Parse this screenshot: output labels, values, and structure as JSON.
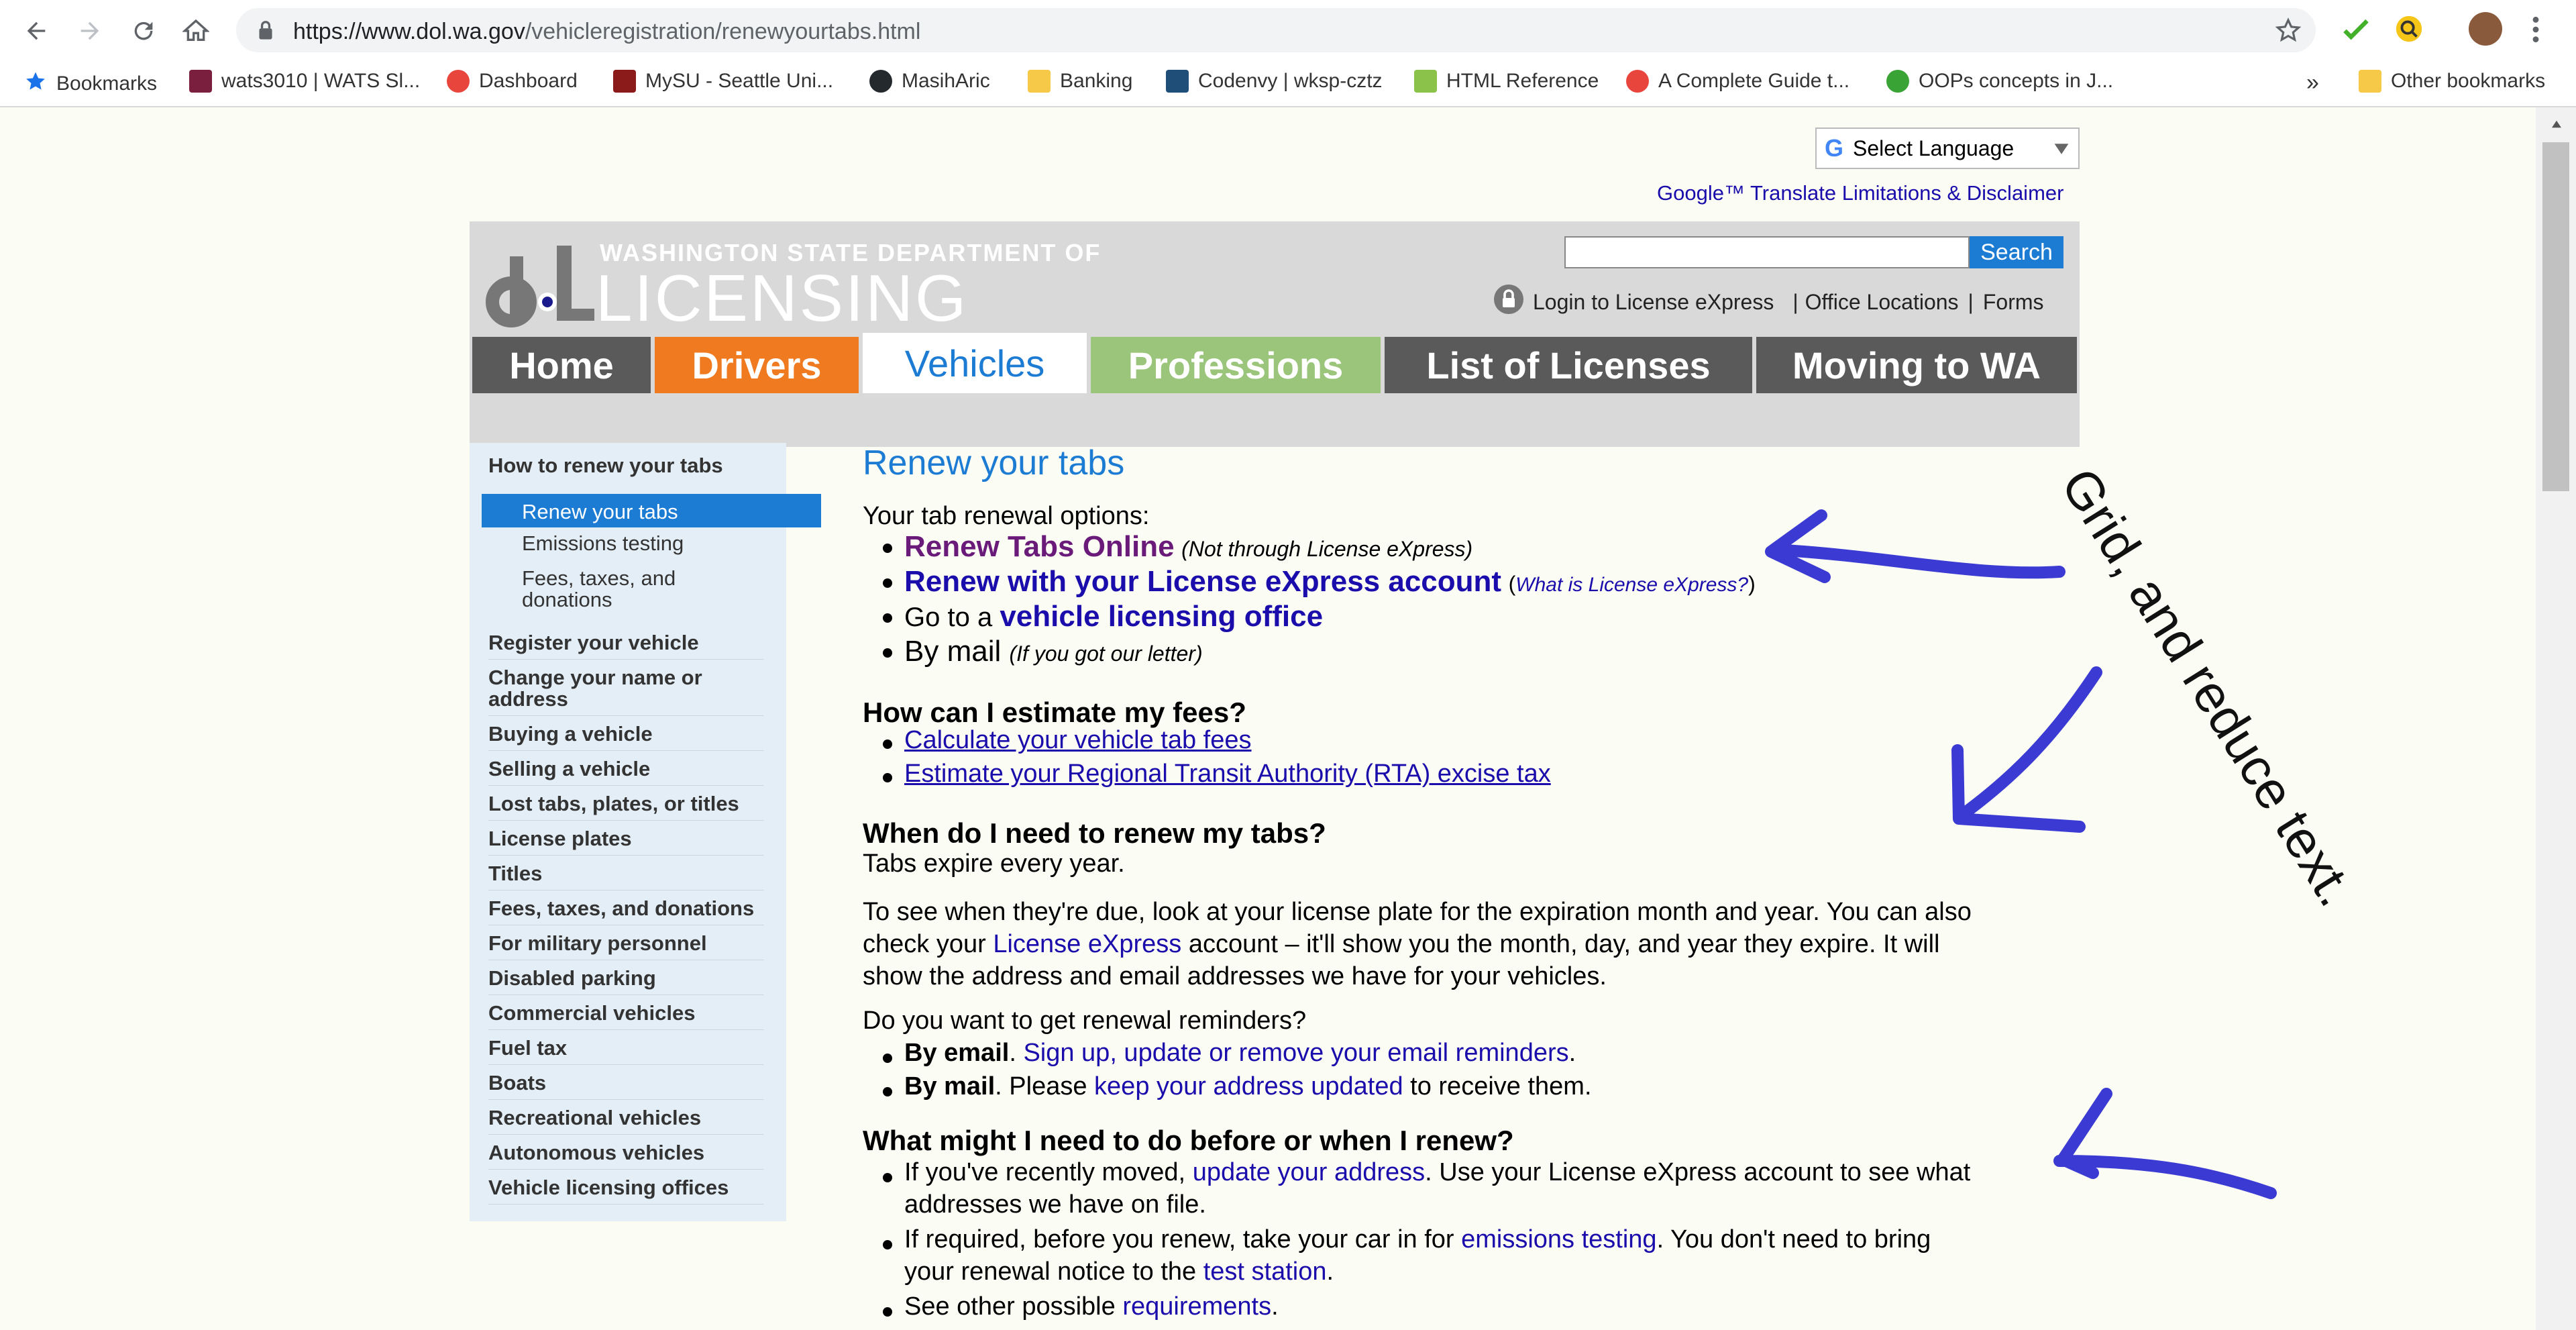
{
  "browser": {
    "url_host": "https://www.dol.wa.gov",
    "url_path": "/vehicleregistration/renewyourtabs.html",
    "bookmarks": [
      {
        "label": "Bookmarks",
        "color": "#1a73e8"
      },
      {
        "label": "wats3010 | WATS Sl...",
        "color": "#7a1f3d"
      },
      {
        "label": "Dashboard",
        "color": "#e8453c"
      },
      {
        "label": "MySU - Seattle Uni...",
        "color": "#8b1a1a"
      },
      {
        "label": "MasihAric",
        "color": "#24292e"
      },
      {
        "label": "Banking",
        "color": "#f7c948"
      },
      {
        "label": "Codenvy | wksp-cztz",
        "color": "#1f4e79"
      },
      {
        "label": "HTML Reference",
        "color": "#8bc34a"
      },
      {
        "label": "A Complete Guide t...",
        "color": "#e8453c"
      },
      {
        "label": "OOPs concepts in J...",
        "color": "#3aa335"
      }
    ],
    "more": "»",
    "other_bookmarks": "Other bookmarks"
  },
  "translate": {
    "label": "Select Language",
    "disclaimer": "Google™ Translate Limitations & Disclaimer"
  },
  "header": {
    "logo_line1": "WASHINGTON STATE DEPARTMENT OF",
    "logo_line2": "LICENSING",
    "search_button": "Search",
    "login": "Login to License eXpress",
    "office": "Office Locations",
    "forms": "Forms",
    "sep": "|",
    "tabs": [
      {
        "label": "Home",
        "color": "#5a5a5a"
      },
      {
        "label": "Drivers",
        "color": "#f07a20"
      },
      {
        "label": "Vehicles",
        "color": "#1c7bd3"
      },
      {
        "label": "Professions",
        "color": "#9bc57a"
      },
      {
        "label": "List of Licenses",
        "color": "#5a5a5a"
      },
      {
        "label": "Moving to WA",
        "color": "#5a5a5a"
      }
    ]
  },
  "sidebar": {
    "heading": "How to renew your tabs",
    "sub": [
      "Renew your tabs",
      "Emissions testing",
      "Fees, taxes, and donations"
    ],
    "items": [
      "Register your vehicle",
      "Change your name or address",
      "Buying a vehicle",
      "Selling a vehicle",
      "Lost tabs, plates, or titles",
      "License plates",
      "Titles",
      "Fees, taxes, and donations",
      "For military personnel",
      "Disabled parking",
      "Commercial vehicles",
      "Fuel tax",
      "Boats",
      "Recreational vehicles",
      "Autonomous vehicles",
      "Vehicle licensing offices"
    ]
  },
  "main": {
    "title": "Renew your tabs",
    "options_intro": "Your tab renewal options:",
    "opt1_link": "Renew Tabs Online",
    "opt1_note": "(Not through License eXpress)",
    "opt2_link": "Renew with your License eXpress account",
    "opt2_open": "(",
    "opt2_note": "What is License eXpress?",
    "opt2_close": ")",
    "opt3_text": "Go to a",
    "opt3_link": "vehicle licensing office",
    "opt4_text": "By mail",
    "opt4_note": "(If you got our letter)",
    "fees_heading": "How can I estimate my fees?",
    "fees_link1": "Calculate your vehicle tab fees",
    "fees_link2": "Estimate your Regional Transit Authority (RTA) excise tax",
    "when_heading": "When do I need to renew my tabs?",
    "when_text": "Tabs expire every year.",
    "due_line1": "To see when they're due, look at your license plate for the expiration month and year. You can also",
    "due_line2_pre": "check your",
    "due_line2_link": "License eXpress",
    "due_line2_post": "account – it'll show you the month, day, and year they expire. It will",
    "due_line3": "show the address and email addresses we have for your vehicles.",
    "reminders_q": "Do you want to get renewal reminders?",
    "rem1_bold": "By email",
    "rem1_dot": ".",
    "rem1_link": "Sign up, update or remove your email reminders",
    "rem1_end": ".",
    "rem2_bold": "By mail",
    "rem2_text": ". Please",
    "rem2_link": "keep your address updated",
    "rem2_end": "to receive them.",
    "before_heading": "What might I need to do before or when I renew?",
    "b1_pre": "If you've recently moved,",
    "b1_link": "update your address",
    "b1_post": ". Use your License eXpress account to see what",
    "b1_line2": "addresses we have on file.",
    "b2_pre": "If required, before you renew, take your car in for",
    "b2_link": "emissions testing",
    "b2_post": ". You don't need to bring",
    "b2_line2_pre": "your renewal notice to the",
    "b2_line2_link": "test station",
    "b2_line2_end": ".",
    "b3_pre": "See other possible",
    "b3_link": "requirements",
    "b3_end": "."
  },
  "annotation": {
    "text": "Grid, and reduce text.",
    "color": "#3b3bd4"
  }
}
